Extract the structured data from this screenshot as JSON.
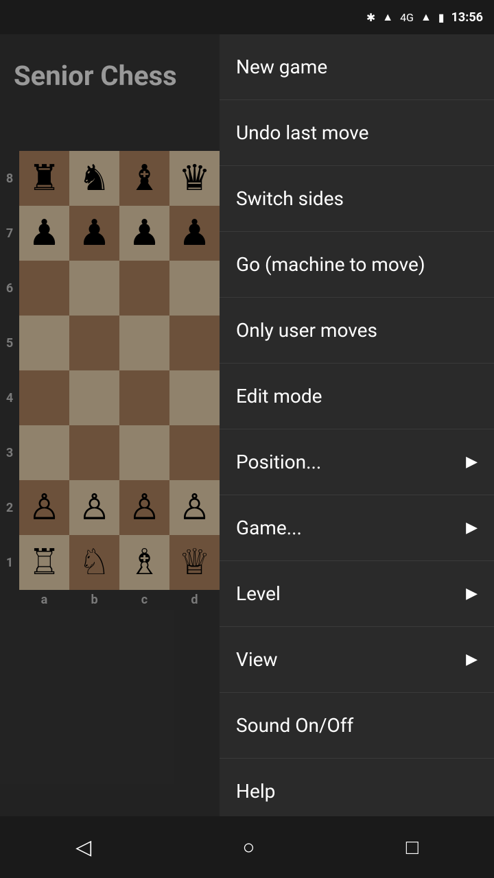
{
  "statusBar": {
    "time": "13:56",
    "bluetooth": "⚡",
    "wifi": "▲",
    "signal": "4G",
    "battery": "🔋"
  },
  "appTitle": "Senior Chess",
  "menu": {
    "items": [
      {
        "id": "new-game",
        "label": "New game",
        "hasArrow": false
      },
      {
        "id": "undo-last-move",
        "label": "Undo last move",
        "hasArrow": false
      },
      {
        "id": "switch-sides",
        "label": "Switch sides",
        "hasArrow": false
      },
      {
        "id": "go-machine",
        "label": "Go (machine to move)",
        "hasArrow": false
      },
      {
        "id": "only-user-moves",
        "label": "Only user moves",
        "hasArrow": false
      },
      {
        "id": "edit-mode",
        "label": "Edit mode",
        "hasArrow": false
      },
      {
        "id": "position",
        "label": "Position...",
        "hasArrow": true
      },
      {
        "id": "game",
        "label": "Game...",
        "hasArrow": true
      },
      {
        "id": "level",
        "label": "Level",
        "hasArrow": true
      },
      {
        "id": "view",
        "label": "View",
        "hasArrow": true
      },
      {
        "id": "sound-onoff",
        "label": "Sound On/Off",
        "hasArrow": false
      },
      {
        "id": "help",
        "label": "Help",
        "hasArrow": false
      }
    ]
  },
  "board": {
    "rowLabels": [
      "8",
      "7",
      "6",
      "5",
      "4",
      "3",
      "2",
      "1"
    ],
    "colLabels": [
      "a",
      "b",
      "c",
      "d"
    ],
    "pieces": {
      "8": {
        "a": "♜",
        "b": "♞",
        "c": "♝",
        "d": "♛"
      },
      "7": {
        "a": "♟",
        "b": "♟",
        "c": "♟",
        "d": "♟"
      },
      "6": {
        "a": "",
        "b": "",
        "c": "",
        "d": ""
      },
      "5": {
        "a": "",
        "b": "",
        "c": "",
        "d": ""
      },
      "4": {
        "a": "",
        "b": "",
        "c": "",
        "d": ""
      },
      "3": {
        "a": "",
        "b": "",
        "c": "",
        "d": ""
      },
      "2": {
        "a": "♙",
        "b": "♙",
        "c": "♙",
        "d": "♙"
      },
      "1": {
        "a": "♖",
        "b": "♘",
        "c": "♗",
        "d": "♕"
      }
    }
  },
  "navBar": {
    "backLabel": "◁",
    "homeLabel": "○",
    "recentLabel": "□"
  }
}
